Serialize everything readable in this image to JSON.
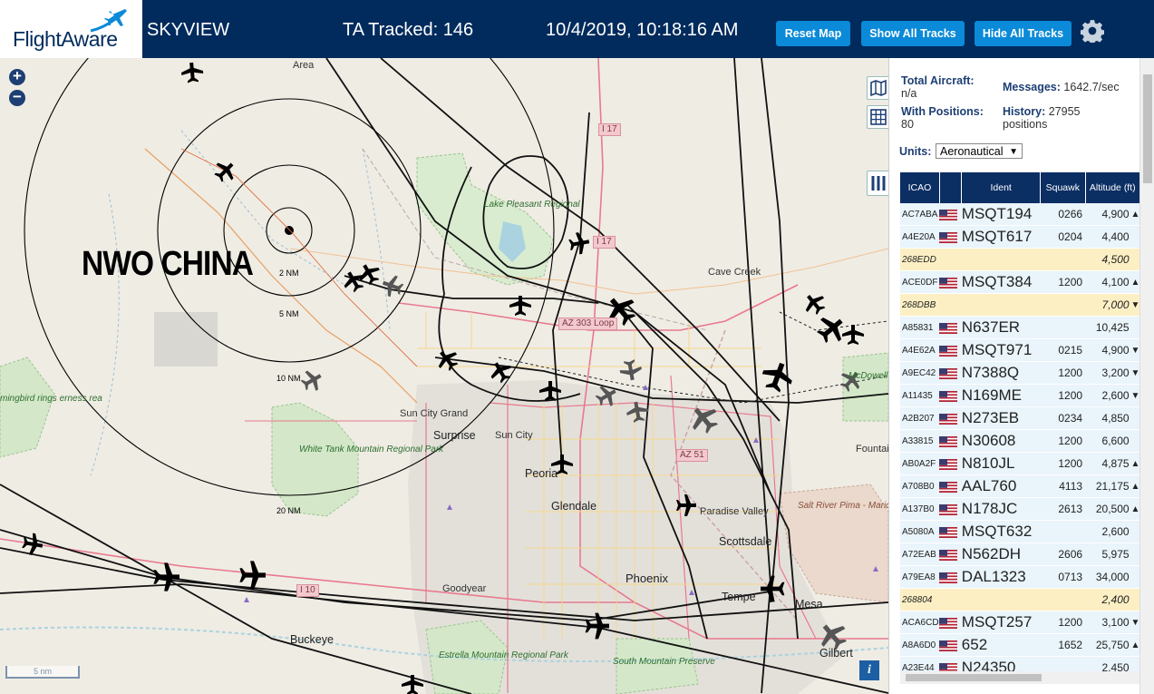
{
  "header": {
    "logo": "FlightAware",
    "app_title": "SKYVIEW",
    "tracked": "TA Tracked: 146",
    "clock": "10/4/2019, 10:18:16 AM",
    "buttons": {
      "reset": "Reset Map",
      "show": "Show All Tracks",
      "hide": "Hide All Tracks"
    },
    "settings_icon": "gear-icon"
  },
  "map": {
    "overlay_text": "NWO CHINA",
    "rings": [
      "2 NM",
      "5 NM",
      "10 NM",
      "20 NM"
    ],
    "scale": "5 nm",
    "zoom_in": "+",
    "zoom_out": "−",
    "info": "i",
    "places": {
      "area": "Area",
      "cave_creek": "Cave Creek",
      "sun_city_grand": "Sun City Grand",
      "surprise": "Surprise",
      "sun_city": "Sun City",
      "peoria": "Peoria",
      "glendale": "Glendale",
      "paradise_valley": "Paradise Valley",
      "scottsdale": "Scottsdale",
      "phoenix": "Phoenix",
      "tempe": "Tempe",
      "mesa": "Mesa",
      "gilbert": "Gilbert",
      "goodyear": "Goodyear",
      "buckeye": "Buckeye",
      "fountain": "Fountai",
      "lake_pleasant": "Lake Pleasant Regional",
      "white_tank": "White Tank Mountain Regional Park",
      "hummingbird": "mingbird rings erness rea",
      "mcdowell": "McDowell Mountain Regional Park",
      "salt_river": "Salt River Pima - Maricopa Indian Community",
      "estrella": "Estrella Mountain Regional Park",
      "south_mountain": "South Mountain Preserve"
    },
    "shields": {
      "i17a": "I 17",
      "i17b": "I 17",
      "loop303": "AZ 303 Loop",
      "az51": "AZ 51",
      "i10": "I 10"
    }
  },
  "sidebar": {
    "total_aircraft_label": "Total Aircraft:",
    "total_aircraft_value": "n/a",
    "with_positions_label": "With Positions:",
    "with_positions_value": "80",
    "messages_label": "Messages:",
    "messages_value": "1642.7/sec",
    "history_label": "History:",
    "history_value": "27955",
    "history_unit": "positions",
    "units_label": "Units:",
    "units_value": "Aeronautical",
    "columns": [
      "ICAO",
      "",
      "Ident",
      "Squawk",
      "Altitude (ft)"
    ],
    "rows": [
      {
        "icao": "AC7ABA",
        "flag": true,
        "ident": "MSQT194",
        "squawk": "0266",
        "alt": "4,900",
        "vr": "▲",
        "sel": false
      },
      {
        "icao": "A4E20A",
        "flag": true,
        "ident": "MSQT617",
        "squawk": "0204",
        "alt": "4,400",
        "vr": "",
        "sel": false
      },
      {
        "icao": "268EDD",
        "flag": false,
        "ident": "",
        "squawk": "",
        "alt": "4,500",
        "vr": "",
        "sel": true
      },
      {
        "icao": "ACE0DF",
        "flag": true,
        "ident": "MSQT384",
        "squawk": "1200",
        "alt": "4,100",
        "vr": "▲",
        "sel": false
      },
      {
        "icao": "268DBB",
        "flag": false,
        "ident": "",
        "squawk": "",
        "alt": "7,000",
        "vr": "▼",
        "sel": true
      },
      {
        "icao": "A85831",
        "flag": true,
        "ident": "N637ER",
        "squawk": "",
        "alt": "10,425",
        "vr": "",
        "sel": false
      },
      {
        "icao": "A4E62A",
        "flag": true,
        "ident": "MSQT971",
        "squawk": "0215",
        "alt": "4,900",
        "vr": "▼",
        "sel": false
      },
      {
        "icao": "A9EC42",
        "flag": true,
        "ident": "N7388Q",
        "squawk": "1200",
        "alt": "3,200",
        "vr": "▼",
        "sel": false
      },
      {
        "icao": "A11435",
        "flag": true,
        "ident": "N169ME",
        "squawk": "1200",
        "alt": "2,600",
        "vr": "▼",
        "sel": false
      },
      {
        "icao": "A2B207",
        "flag": true,
        "ident": "N273EB",
        "squawk": "0234",
        "alt": "4,850",
        "vr": "",
        "sel": false
      },
      {
        "icao": "A33815",
        "flag": true,
        "ident": "N30608",
        "squawk": "1200",
        "alt": "6,600",
        "vr": "",
        "sel": false
      },
      {
        "icao": "AB0A2F",
        "flag": true,
        "ident": "N810JL",
        "squawk": "1200",
        "alt": "4,875",
        "vr": "▲",
        "sel": false
      },
      {
        "icao": "A708B0",
        "flag": true,
        "ident": "AAL760",
        "squawk": "4113",
        "alt": "21,175",
        "vr": "▲",
        "sel": false
      },
      {
        "icao": "A137B0",
        "flag": true,
        "ident": "N178JC",
        "squawk": "2613",
        "alt": "20,500",
        "vr": "▲",
        "sel": false
      },
      {
        "icao": "A5080A",
        "flag": true,
        "ident": "MSQT632",
        "squawk": "",
        "alt": "2,600",
        "vr": "",
        "sel": false
      },
      {
        "icao": "A72EAB",
        "flag": true,
        "ident": "N562DH",
        "squawk": "2606",
        "alt": "5,975",
        "vr": "",
        "sel": false
      },
      {
        "icao": "A79EA8",
        "flag": true,
        "ident": "DAL1323",
        "squawk": "0713",
        "alt": "34,000",
        "vr": "",
        "sel": false
      },
      {
        "icao": "268804",
        "flag": false,
        "ident": "",
        "squawk": "",
        "alt": "2,400",
        "vr": "",
        "sel": true
      },
      {
        "icao": "ACA6CD",
        "flag": true,
        "ident": "MSQT257",
        "squawk": "1200",
        "alt": "3,100",
        "vr": "▼",
        "sel": false
      },
      {
        "icao": "A8A6D0",
        "flag": true,
        "ident": "652",
        "squawk": "1652",
        "alt": "25,750",
        "vr": "▲",
        "sel": false
      },
      {
        "icao": "A23E44",
        "flag": true,
        "ident": "N24350",
        "squawk": "",
        "alt": "2,450",
        "vr": "",
        "sel": false
      }
    ]
  }
}
